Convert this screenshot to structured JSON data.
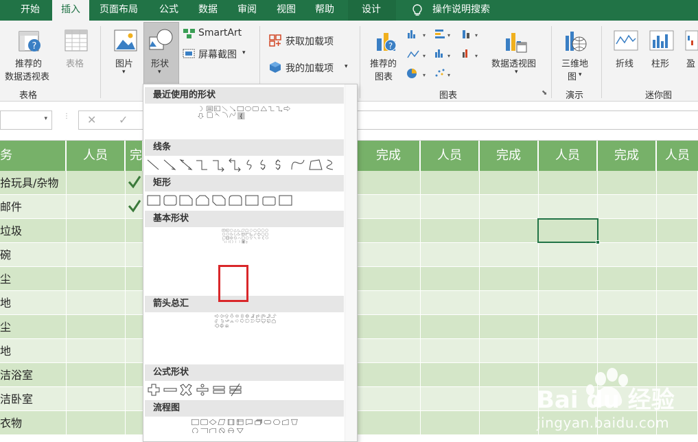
{
  "tabs": [
    "开始",
    "插入",
    "页面布局",
    "公式",
    "数据",
    "审阅",
    "视图",
    "帮助",
    "设计"
  ],
  "active_tab": "插入",
  "tell_me": "操作说明搜索",
  "ribbon": {
    "pivot_line1": "推荐的",
    "pivot_line2": "数据透视表",
    "table": "表格",
    "picture": "图片",
    "shapes": "形状",
    "smartart": "SmartArt",
    "screenshot": "屏幕截图",
    "get_addins": "获取加载项",
    "my_addins": "我的加载项",
    "rec_chart_line1": "推荐的",
    "rec_chart_line2": "图表",
    "pivot_chart": "数据透视图",
    "map3d_line1": "三维地",
    "map3d_line2": "图",
    "spark_line": "折线",
    "spark_col": "柱形",
    "spark_wl": "盈",
    "groups": {
      "tables": "表格",
      "charts": "图表",
      "tours": "演示",
      "sparklines": "迷你图"
    }
  },
  "formula_bar": {
    "cancel": "✕",
    "enter": "✓"
  },
  "sheet": {
    "headers": [
      "务",
      "人员",
      "完成",
      "人员",
      "完成",
      "人员",
      "完成",
      "人员"
    ],
    "first_header_extra": "完",
    "rows": [
      {
        "task": "拾玩具/杂物",
        "checked": true
      },
      {
        "task": "邮件",
        "checked": true
      },
      {
        "task": "垃圾",
        "checked": false
      },
      {
        "task": "碗",
        "checked": false
      },
      {
        "task": "尘",
        "checked": false
      },
      {
        "task": "地",
        "checked": false
      },
      {
        "task": "尘",
        "checked": false
      },
      {
        "task": "地",
        "checked": false
      },
      {
        "task": "洁浴室",
        "checked": false
      },
      {
        "task": "洁卧室",
        "checked": false
      },
      {
        "task": "衣物",
        "checked": false
      }
    ]
  },
  "shapes_panel": {
    "sections": [
      "最近使用的形状",
      "线条",
      "矩形",
      "基本形状",
      "箭头总汇",
      "公式形状",
      "流程图"
    ]
  },
  "watermark": {
    "logo": "Bai du 经验",
    "url": "jingyan.baidu.com"
  }
}
